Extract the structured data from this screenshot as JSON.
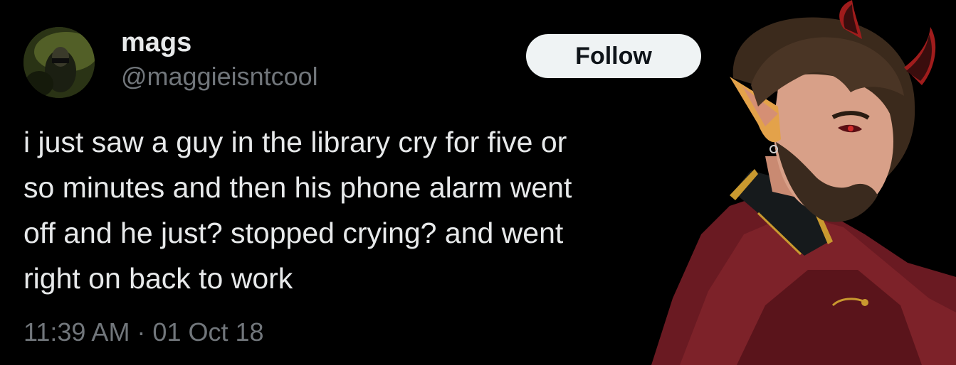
{
  "tweet": {
    "author": {
      "display_name": "mags",
      "handle": "@maggieisntcool",
      "avatar": "profile-avatar"
    },
    "follow_label": "Follow",
    "text_lines": [
      "i just saw a guy in the library cry for five or",
      "so minutes and then his phone alarm went",
      "off and he just? stopped crying? and went",
      "right on back to work"
    ],
    "timestamp": "11:39 AM · 01 Oct 18"
  },
  "art": {
    "name": "demon-character-illustration"
  },
  "colors": {
    "background": "#000000",
    "primary_text": "#e7e9ea",
    "secondary_text": "#71767b",
    "follow_bg": "#eff3f4",
    "follow_text": "#0f1419"
  }
}
